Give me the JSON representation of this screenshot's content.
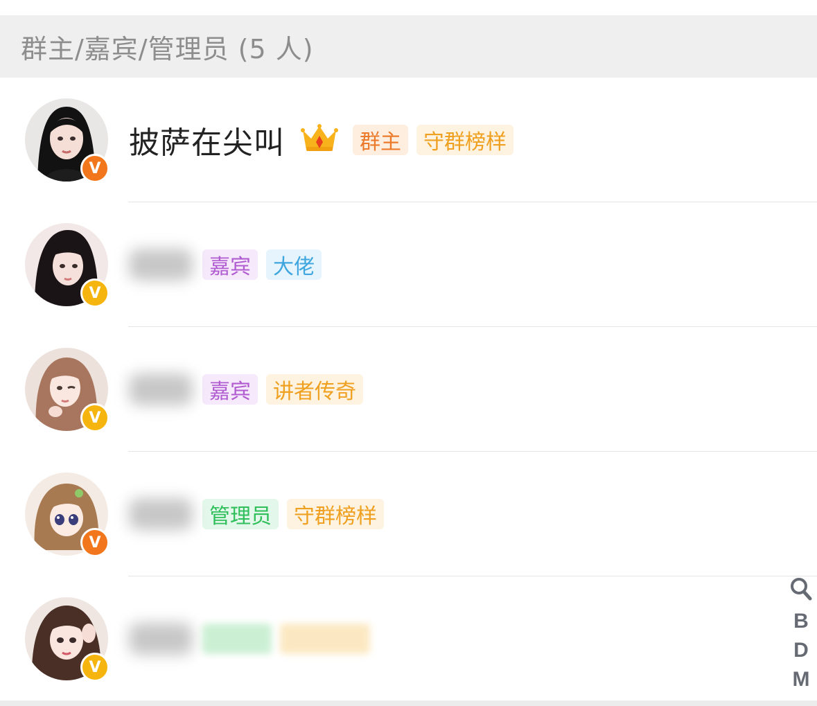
{
  "header": {
    "title": "群主/嘉宾/管理员 (5 人)"
  },
  "members": [
    {
      "name": "披萨在尖叫",
      "name_visible": true,
      "crown": true,
      "badge": "orange",
      "avatar_color": "#2b2b2b",
      "tags": [
        {
          "label": "群主",
          "fg": "#ec7a2b",
          "bg": "#fdeee0"
        },
        {
          "label": "守群榜样",
          "fg": "#f0a020",
          "bg": "#fdf3e0"
        }
      ]
    },
    {
      "name_visible": false,
      "crown": false,
      "badge": "yellow",
      "avatar_color": "#3a2f33",
      "tags": [
        {
          "label": "嘉宾",
          "fg": "#b15cd1",
          "bg": "#f5e9fb"
        },
        {
          "label": "大佬",
          "fg": "#3fa6e0",
          "bg": "#e6f4fd"
        }
      ]
    },
    {
      "name_visible": false,
      "crown": false,
      "badge": "yellow",
      "avatar_color": "#b98f7a",
      "tags": [
        {
          "label": "嘉宾",
          "fg": "#b15cd1",
          "bg": "#f5e9fb"
        },
        {
          "label": "讲者传奇",
          "fg": "#f0a020",
          "bg": "#fdf3e0"
        }
      ]
    },
    {
      "name_visible": false,
      "crown": false,
      "badge": "orange",
      "avatar_color": "#c9a37a",
      "tags": [
        {
          "label": "管理员",
          "fg": "#2fbf5b",
          "bg": "#e3f7ea"
        },
        {
          "label": "守群榜样",
          "fg": "#f0a020",
          "bg": "#fdf3e0"
        }
      ]
    },
    {
      "name_visible": false,
      "crown": false,
      "badge": "yellow",
      "avatar_color": "#5a3f35",
      "tags": [
        {
          "label": "",
          "fg": "#2fbf5b",
          "bg": "#bfecc9",
          "blurred": true
        },
        {
          "label": "",
          "fg": "#f0a020",
          "bg": "#fbe3b3",
          "blurred": true
        }
      ]
    }
  ],
  "index": {
    "search_icon": "search-icon",
    "letters": [
      "B",
      "D",
      "M"
    ]
  }
}
